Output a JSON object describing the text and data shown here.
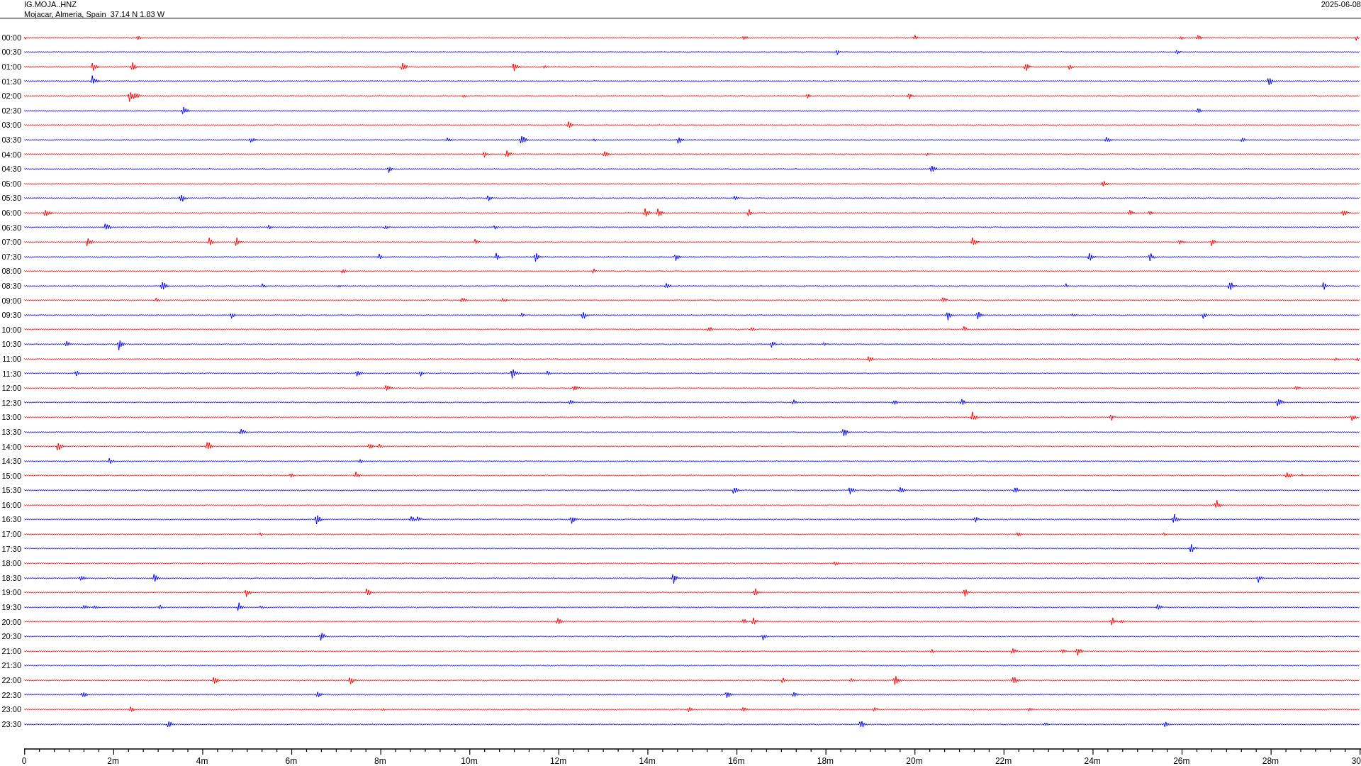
{
  "header": {
    "station": "IG.MOJA..HNZ",
    "location": "Mojacar, Almeria, Spain  37.14 N 1.83 W",
    "date": "2025-06-08"
  },
  "rows": [
    {
      "time": "00:00",
      "color": "#ff0000"
    },
    {
      "time": "00:30",
      "color": "#0000ff"
    },
    {
      "time": "01:00",
      "color": "#ff0000"
    },
    {
      "time": "01:30",
      "color": "#0000ff"
    },
    {
      "time": "02:00",
      "color": "#ff0000"
    },
    {
      "time": "02:30",
      "color": "#0000ff"
    },
    {
      "time": "03:00",
      "color": "#ff0000"
    },
    {
      "time": "03:30",
      "color": "#0000ff"
    },
    {
      "time": "04:00",
      "color": "#ff0000"
    },
    {
      "time": "04:30",
      "color": "#0000ff"
    },
    {
      "time": "05:00",
      "color": "#ff0000"
    },
    {
      "time": "05:30",
      "color": "#0000ff"
    },
    {
      "time": "06:00",
      "color": "#ff0000"
    },
    {
      "time": "06:30",
      "color": "#0000ff"
    },
    {
      "time": "07:00",
      "color": "#ff0000"
    },
    {
      "time": "07:30",
      "color": "#0000ff"
    },
    {
      "time": "08:00",
      "color": "#ff0000"
    },
    {
      "time": "08:30",
      "color": "#0000ff"
    },
    {
      "time": "09:00",
      "color": "#ff0000"
    },
    {
      "time": "09:30",
      "color": "#0000ff"
    },
    {
      "time": "10:00",
      "color": "#ff0000"
    },
    {
      "time": "10:30",
      "color": "#0000ff"
    },
    {
      "time": "11:00",
      "color": "#ff0000"
    },
    {
      "time": "11:30",
      "color": "#0000ff"
    },
    {
      "time": "12:00",
      "color": "#ff0000"
    },
    {
      "time": "12:30",
      "color": "#0000ff"
    },
    {
      "time": "13:00",
      "color": "#ff0000"
    },
    {
      "time": "13:30",
      "color": "#0000ff"
    },
    {
      "time": "14:00",
      "color": "#ff0000"
    },
    {
      "time": "14:30",
      "color": "#0000ff"
    },
    {
      "time": "15:00",
      "color": "#ff0000"
    },
    {
      "time": "15:30",
      "color": "#0000ff"
    },
    {
      "time": "16:00",
      "color": "#ff0000"
    },
    {
      "time": "16:30",
      "color": "#0000ff"
    },
    {
      "time": "17:00",
      "color": "#ff0000"
    },
    {
      "time": "17:30",
      "color": "#0000ff"
    },
    {
      "time": "18:00",
      "color": "#ff0000"
    },
    {
      "time": "18:30",
      "color": "#0000ff"
    },
    {
      "time": "19:00",
      "color": "#ff0000"
    },
    {
      "time": "19:30",
      "color": "#0000ff"
    },
    {
      "time": "20:00",
      "color": "#ff0000"
    },
    {
      "time": "20:30",
      "color": "#0000ff"
    },
    {
      "time": "21:00",
      "color": "#ff0000"
    },
    {
      "time": "21:30",
      "color": "#0000ff"
    },
    {
      "time": "22:00",
      "color": "#ff0000"
    },
    {
      "time": "22:30",
      "color": "#0000ff"
    },
    {
      "time": "23:00",
      "color": "#ff0000"
    },
    {
      "time": "23:30",
      "color": "#0000ff"
    }
  ],
  "x_axis": {
    "ticks": [
      "0",
      "2m",
      "4m",
      "6m",
      "8m",
      "10m",
      "12m",
      "14m",
      "16m",
      "18m",
      "20m",
      "22m",
      "24m",
      "26m",
      "28m",
      "30"
    ]
  }
}
